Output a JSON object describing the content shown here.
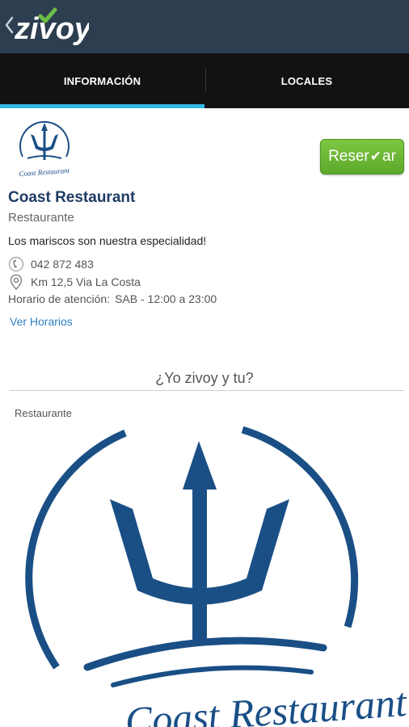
{
  "header": {
    "brand": "zivoy",
    "back_icon": "chevron-left-icon"
  },
  "tabs": [
    {
      "label": "INFORMACIÓN",
      "selected": true
    },
    {
      "label": "LOCALES",
      "selected": false
    }
  ],
  "restaurant": {
    "logo_text": "Coast Restaurant",
    "name": "Coast Restaurant",
    "category": "Restaurante",
    "description": "Los mariscos son nuestra especialidad!",
    "phone": "042 872 483",
    "address": "Km 12,5 Via La Costa",
    "hours_label": "Horario de atención:",
    "hours_value": "SAB - 12:00 a 23:00",
    "more_hours_link": "Ver Horarios"
  },
  "reserve_button": {
    "label_start": "Reser",
    "label_end": "ar"
  },
  "footer": {
    "tagline": "¿Yo zivoy y tu?",
    "category": "Restaurante",
    "logo_text": "Coast Restaurant"
  },
  "colors": {
    "appbar": "#2c3e50",
    "tab_bar": "#121212",
    "tab_indicator": "#33b5e5",
    "brand_green": "#6cbe45",
    "logo_blue": "#1a4f86",
    "reserve_green": "#6ab836"
  }
}
